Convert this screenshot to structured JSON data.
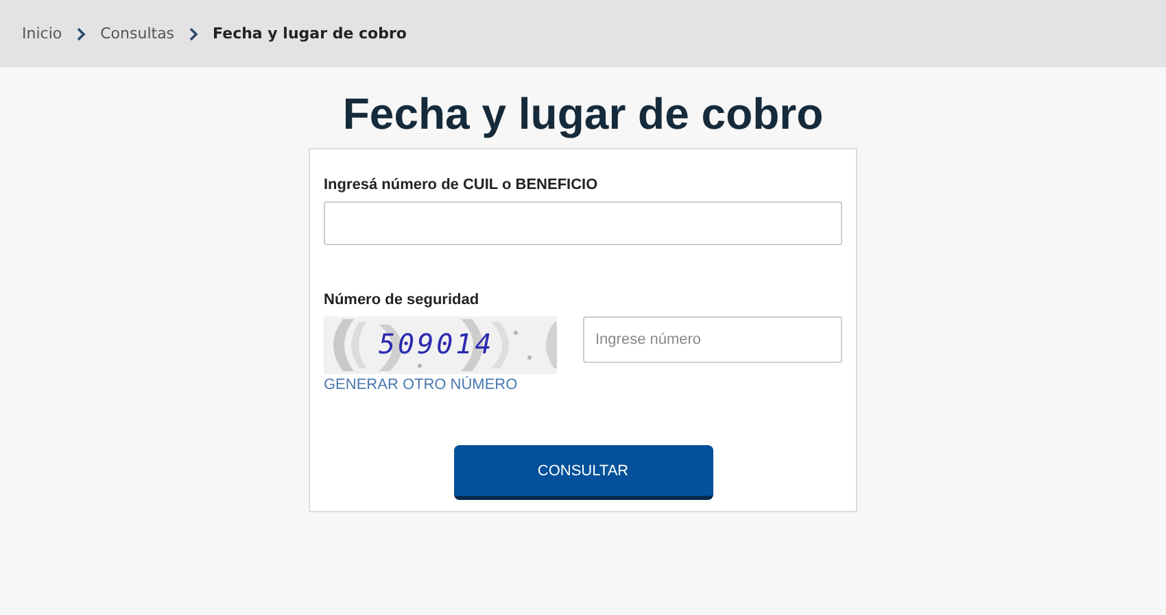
{
  "breadcrumb": [
    {
      "label": "Inicio",
      "current": false
    },
    {
      "label": "Consultas",
      "current": false
    },
    {
      "label": "Fecha y lugar de cobro",
      "current": true
    }
  ],
  "title": "Fecha y lugar de cobro",
  "form": {
    "id_label": "Ingresá número de CUIL o BENEFICIO",
    "security_label": "Número de seguridad",
    "captcha_text": "509014",
    "security_placeholder": "Ingrese número",
    "regenerate_link": "GENERAR OTRO NÚMERO",
    "submit": "CONSULTAR"
  }
}
